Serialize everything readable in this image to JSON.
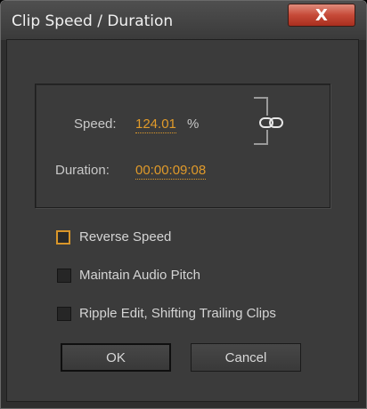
{
  "window": {
    "title": "Clip Speed / Duration",
    "close_label": "X"
  },
  "speed": {
    "label": "Speed:",
    "value": "124.01",
    "unit": "%"
  },
  "duration": {
    "label": "Duration:",
    "value": "00:00:09:08"
  },
  "link": {
    "icon": "chain-link-icon",
    "linked": true
  },
  "options": [
    {
      "label": "Reverse Speed",
      "checked": false,
      "focused": true
    },
    {
      "label": "Maintain Audio Pitch",
      "checked": false,
      "focused": false
    },
    {
      "label": "Ripple Edit, Shifting Trailing Clips",
      "checked": false,
      "focused": false
    }
  ],
  "buttons": {
    "ok": "OK",
    "cancel": "Cancel"
  },
  "colors": {
    "accent": "#e09a2a",
    "close": "#c64a38",
    "background": "#3b3b3b"
  }
}
